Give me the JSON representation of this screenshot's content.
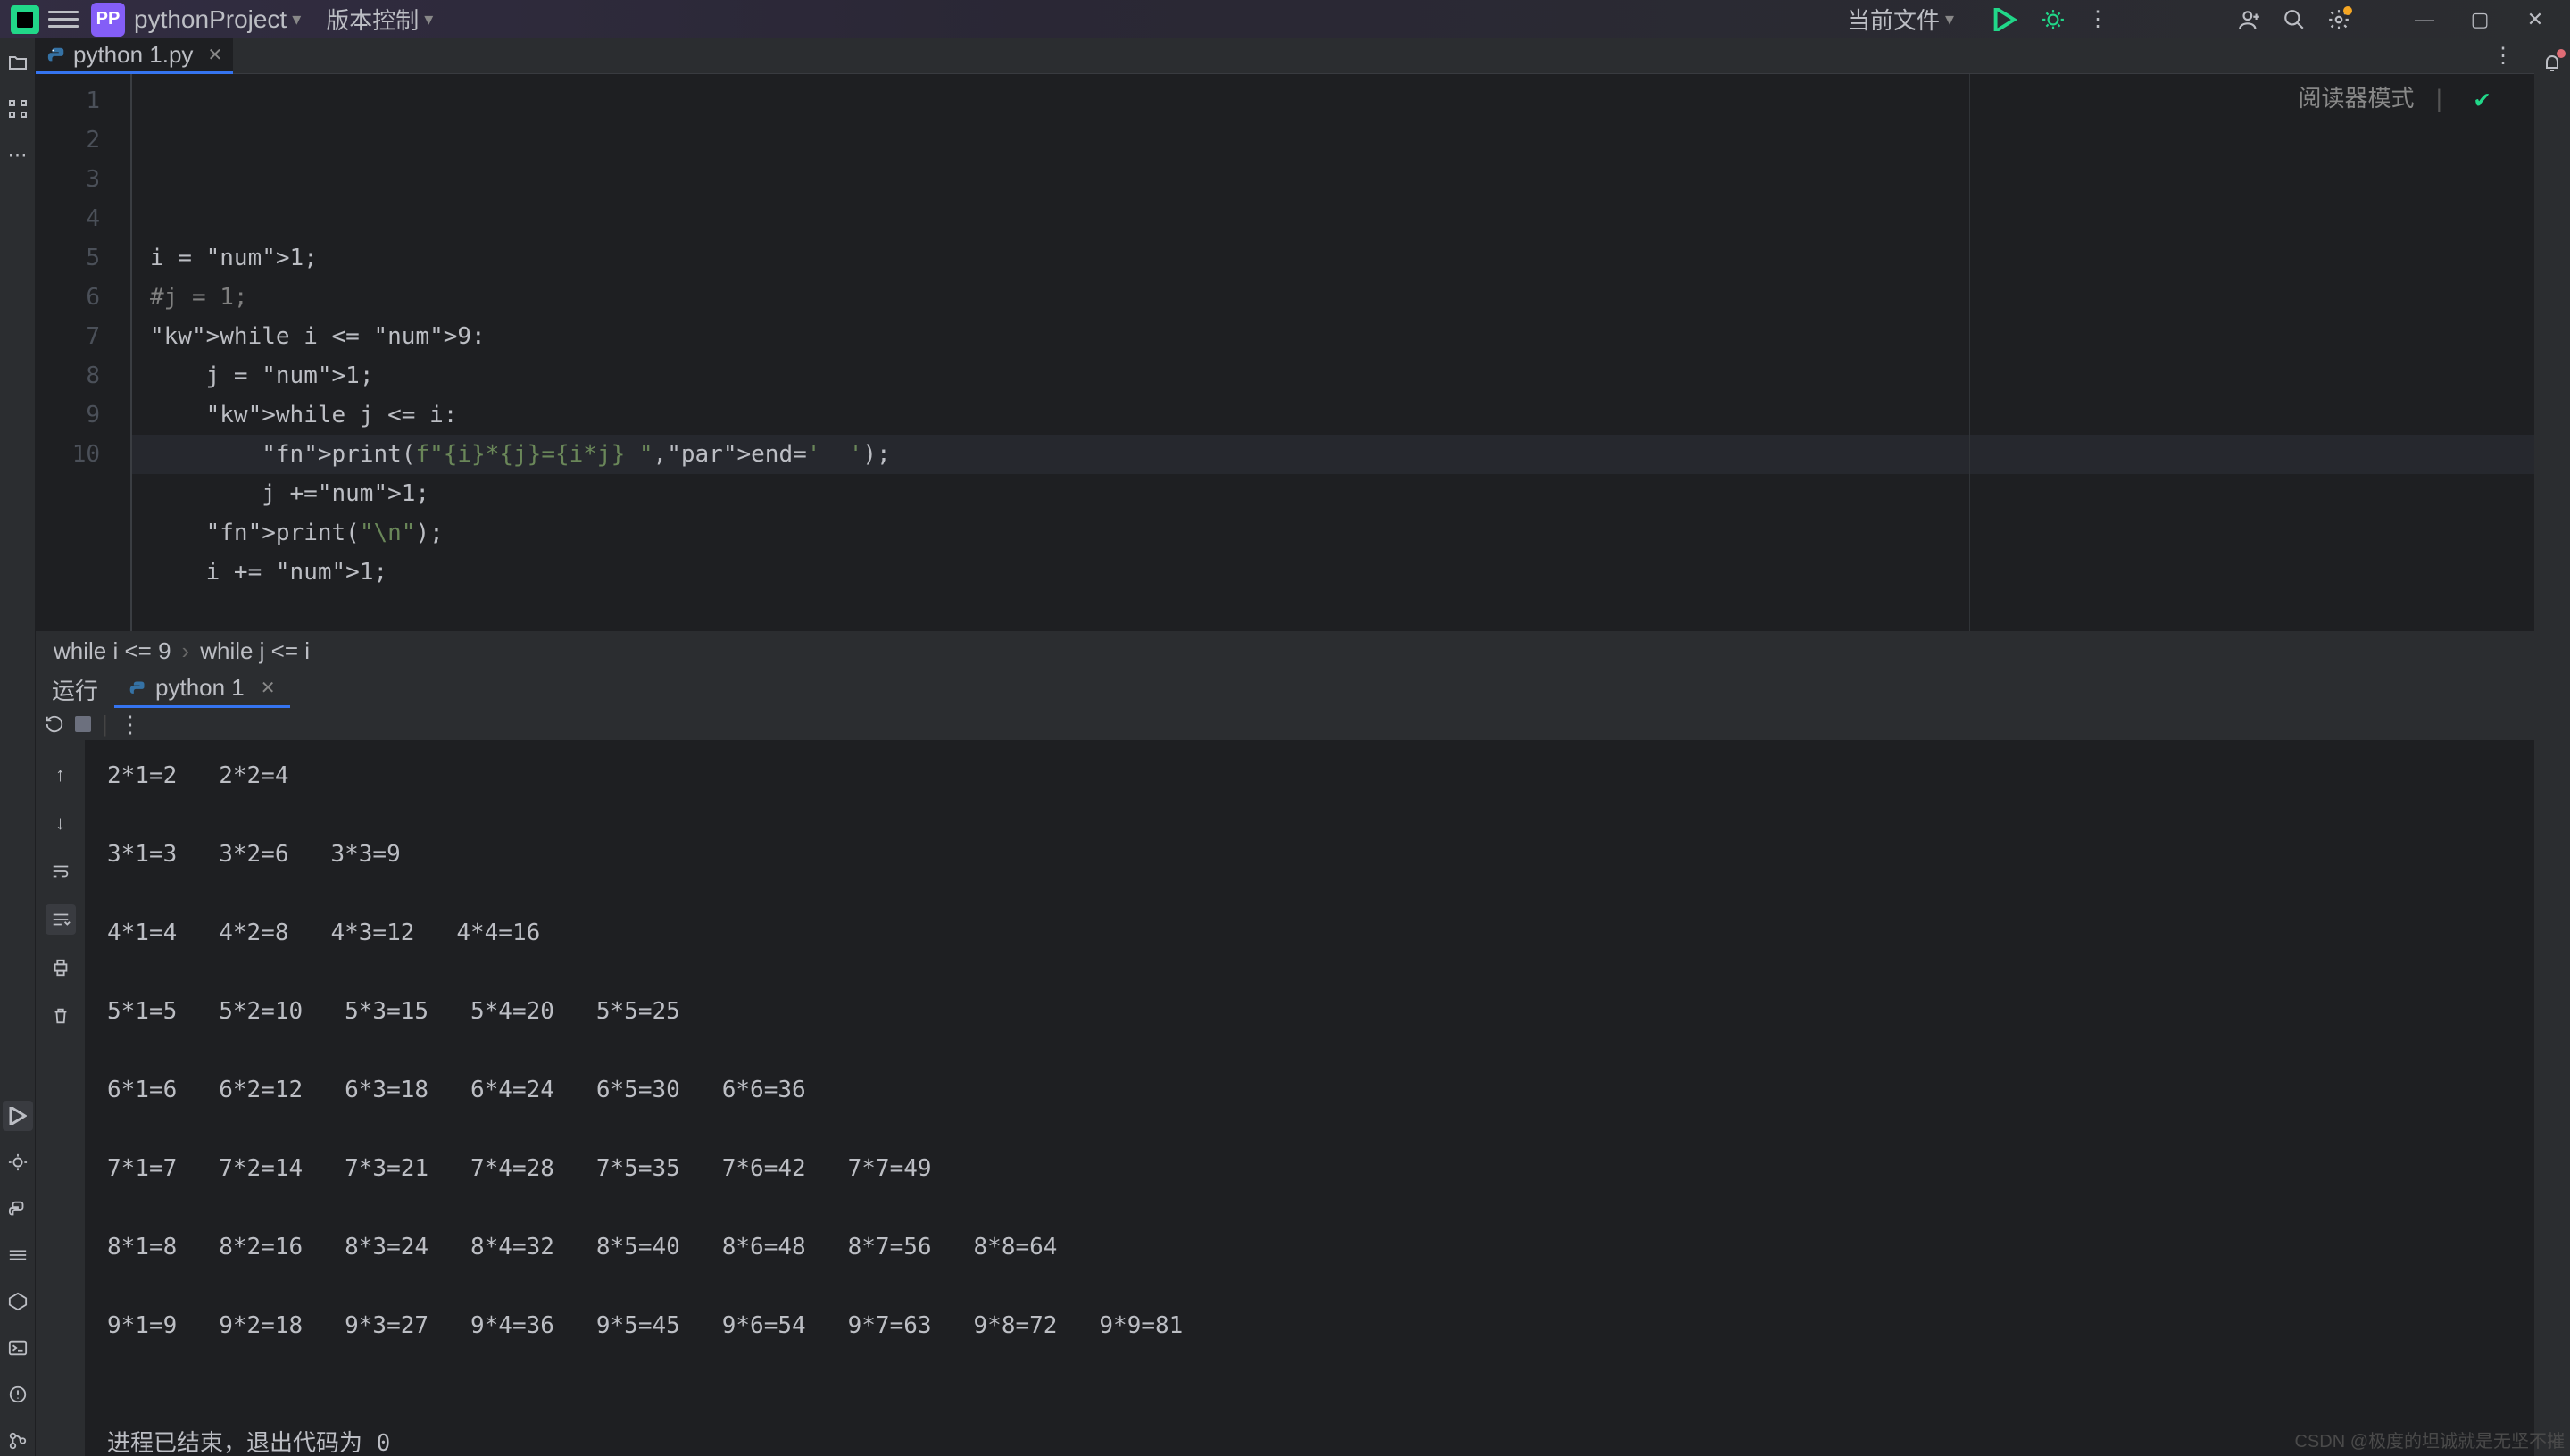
{
  "titlebar": {
    "project": "pythonProject",
    "vcs": "版本控制",
    "current_file": "当前文件"
  },
  "file_tab": {
    "name": "python 1.py"
  },
  "reader_mode": "阅读器模式",
  "breadcrumbs": {
    "a": "while i <= 9",
    "sep": "›",
    "b": "while j <= i"
  },
  "run": {
    "label": "运行",
    "tab": "python 1"
  },
  "code_lines": [
    "i = 1;",
    "#j = 1;",
    "while i <= 9:",
    "    j = 1;",
    "    while j <= i:",
    "        print(f\"{i}*{j}={i*j} \",end='  ');",
    "        j +=1;",
    "    print(\"\\n\");",
    "    i += 1;",
    ""
  ],
  "console_lines": [
    "2*1=2   2*2=4",
    "",
    "3*1=3   3*2=6   3*3=9",
    "",
    "4*1=4   4*2=8   4*3=12   4*4=16",
    "",
    "5*1=5   5*2=10   5*3=15   5*4=20   5*5=25",
    "",
    "6*1=6   6*2=12   6*3=18   6*4=24   6*5=30   6*6=36",
    "",
    "7*1=7   7*2=14   7*3=21   7*4=28   7*5=35   7*6=42   7*7=49",
    "",
    "8*1=8   8*2=16   8*3=24   8*4=32   8*5=40   8*6=48   8*7=56   8*8=64",
    "",
    "9*1=9   9*2=18   9*3=27   9*4=36   9*5=45   9*6=54   9*7=63   9*8=72   9*9=81",
    "",
    "",
    "进程已结束，退出代码为 0"
  ],
  "watermark": "CSDN @极度的坦诚就是无坚不摧"
}
